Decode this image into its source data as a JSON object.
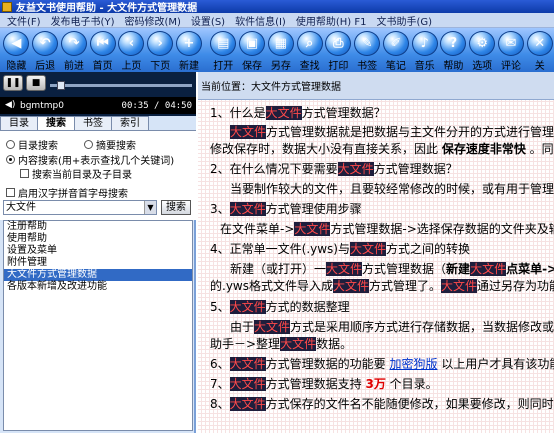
{
  "window": {
    "title": "友益文书使用帮助 - 大文件方式管理数据"
  },
  "menu": [
    "文件(F)",
    "发布电子书(Y)",
    "密码修改(M)",
    "设置(S)",
    "软件信息(I)",
    "使用帮助(H) F1",
    "文书助手(G)"
  ],
  "toolbar": [
    {
      "label": "隐藏",
      "icon": "hide-icon",
      "glyph": "◀"
    },
    {
      "label": "后退",
      "icon": "back-icon",
      "glyph": "↶"
    },
    {
      "label": "前进",
      "icon": "forward-icon",
      "glyph": "↷"
    },
    {
      "label": "首页",
      "icon": "first-page-icon",
      "glyph": "⏮"
    },
    {
      "label": "上页",
      "icon": "prev-page-icon",
      "glyph": "‹"
    },
    {
      "label": "下页",
      "icon": "next-page-icon",
      "glyph": "›"
    },
    {
      "label": "新建",
      "icon": "new-icon",
      "glyph": "+"
    },
    {
      "label": "打开",
      "icon": "open-icon",
      "glyph": "▤"
    },
    {
      "label": "保存",
      "icon": "save-icon",
      "glyph": "▣"
    },
    {
      "label": "另存",
      "icon": "save-as-icon",
      "glyph": "▦"
    },
    {
      "label": "查找",
      "icon": "find-icon",
      "glyph": "⌕"
    },
    {
      "label": "打印",
      "icon": "print-icon",
      "glyph": "⎙"
    },
    {
      "label": "书签",
      "icon": "bookmark-icon",
      "glyph": "✎"
    },
    {
      "label": "笔记",
      "icon": "note-icon",
      "glyph": "✐"
    },
    {
      "label": "音乐",
      "icon": "music-icon",
      "glyph": "♪"
    },
    {
      "label": "帮助",
      "icon": "help-icon",
      "glyph": "?"
    },
    {
      "label": "选项",
      "icon": "options-icon",
      "glyph": "⚙"
    },
    {
      "label": "评论",
      "icon": "comment-icon",
      "glyph": "✉"
    },
    {
      "label": "关",
      "icon": "close-icon",
      "glyph": "✕"
    }
  ],
  "player": {
    "filename": "bgmtmp0",
    "time": "00:35 / 04:50",
    "progress": 0.05
  },
  "tabs": [
    "目录",
    "搜索",
    "书签",
    "索引"
  ],
  "search": {
    "options": {
      "directory": "目录搜索",
      "summary": "摘要搜索",
      "content": "内容搜索(用+表示查找几个关键词)",
      "only_current": "搜索当前目录及子目录",
      "pinyin": "启用汉字拼音首字母搜索"
    },
    "query": "大文件",
    "button": "搜索",
    "results": [
      "注册帮助",
      "使用帮助",
      "设置及菜单",
      "附件管理",
      "大文件方式管理数据",
      "各版本新增及改进功能"
    ],
    "selected_index": 4
  },
  "location": {
    "label": "当前位置：",
    "value": "大文件方式管理数据"
  },
  "content": {
    "l1": {
      "a": "1、什么是",
      "hl": "大文件",
      "b": "方式管理数据？"
    },
    "l2": {
      "hl": "大文件",
      "a": "方式管理数据就是把数据与主文件分开的方式进行管理，比如"
    },
    "l3": {
      "a": "修改保存时，数据大小没有直接关系，因此 ",
      "bold": "保存速度非常快",
      "b": " 。同时"
    },
    "l4": {
      "a": "2、在什么情况下要需要",
      "hl": "大文件",
      "b": "方式管理数据？"
    },
    "l5": {
      "a": "当要制作较大的文件，且要较经常修改的时候，或有用于管理经常"
    },
    "l6": {
      "a": "3、",
      "hl": "大文件",
      "b": "方式管理使用步骤"
    },
    "l7": {
      "a": "在文件菜单->",
      "hl": "大文件",
      "b": "方式管理数据->选择保存数据的文件夹及输入文件"
    },
    "l8": {
      "a": "4、正常单一文件(.yws)与",
      "hl": "大文件",
      "b": "方式之间的转换"
    },
    "l9": {
      "a": "新建（或打开）一",
      "hl": "大文件",
      "b": "方式管理数据（",
      "bold": "新建",
      "hl2": "大文件",
      "bold2": "点菜单->文件"
    },
    "l10": {
      "a": "的.yws格式文件导入成",
      "hl": "大文件",
      "b": "方式管理了。",
      "hl2": "大文件",
      "c": "通过另存为功能就可以"
    },
    "l11": {
      "a": "5、",
      "hl": "大文件",
      "b": "方式的数据整理"
    },
    "l12": {
      "a": "由于",
      "hl": "大文件",
      "b": "方式是采用顺序方式进行存储数据，当数据修改或删除时"
    },
    "l13": {
      "a": "助手－>整理",
      "hl": "大文件",
      "b": "数据。"
    },
    "l14": {
      "a": "6、",
      "hl": "大文件",
      "b": "方式管理数据的功能要 ",
      "link": "加密狗版",
      "c": " 以上用户才具有该功能。"
    },
    "l15": {
      "a": "7、",
      "hl": "大文件",
      "b": "方式管理数据支持 ",
      "red": "3万",
      "c": " 个目录。"
    },
    "l16": {
      "a": "8、",
      "hl": "大文件",
      "b": "方式保存的文件名不能随便修改，如果要修改，则同时要把同"
    }
  }
}
